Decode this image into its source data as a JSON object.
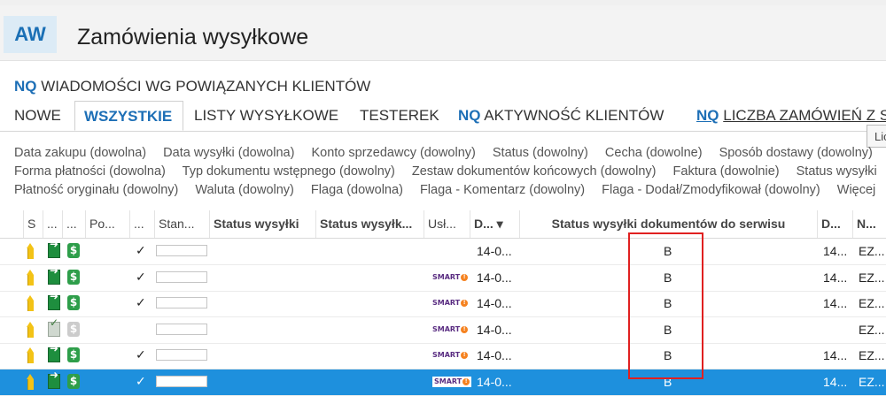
{
  "app": {
    "logo": "AW",
    "title": "Zamówienia wysyłkowe"
  },
  "saved_view": {
    "prefix": "NQ",
    "label": "WIADOMOŚCI WG POWIĄZANYCH KLIENTÓW"
  },
  "tabs": [
    {
      "label": "NOWE"
    },
    {
      "label": "WSZYSTKIE",
      "active": true
    },
    {
      "label": "LISTY WYSYŁKOWE"
    },
    {
      "label": "TESTEREK"
    },
    {
      "prefix": "NQ",
      "label": "AKTYWNOŚĆ KLIENTÓW"
    },
    {
      "prefix": "NQ",
      "label": "LICZBA ZAMÓWIEŃ Z S"
    }
  ],
  "tooltip": "Lic",
  "filters": {
    "row1": [
      "Data zakupu (dowolna)",
      "Data wysyłki (dowolna)",
      "Konto sprzedawcy (dowolny)",
      "Status (dowolny)",
      "Cecha (dowolne)",
      "Sposób dostawy (dowolny)"
    ],
    "row2": [
      "Forma płatności (dowolna)",
      "Typ dokumentu wstępnego (dowolny)",
      "Zestaw dokumentów końcowych (dowolny)",
      "Faktura (dowolnie)",
      "Status wysyłki"
    ],
    "row3": [
      "Płatność oryginału (dowolny)",
      "Waluta (dowolny)",
      "Flaga (dowolna)",
      "Flaga - Komentarz (dowolny)",
      "Flaga - Dodał/Zmodyfikował (dowolny)",
      "Więcej"
    ]
  },
  "grid": {
    "headers": {
      "c0": "",
      "c1": "S",
      "c2": "...",
      "c3": "...",
      "c4": "Po...",
      "c5": "...",
      "c6": "Stan...",
      "c7": "Status wysyłki",
      "c8": "Status wysyłk...",
      "c9": "Usł...",
      "c10": "D... ▾",
      "c11": "Status wysyłki dokumentów do serwisu",
      "c12": "D...",
      "c13": "N..."
    },
    "rows": [
      {
        "check": "✓",
        "smart": false,
        "date": "14-0...",
        "status_doc": "B",
        "d": "14...",
        "n": "EZ...",
        "gray": false,
        "selected": false
      },
      {
        "check": "✓",
        "smart": true,
        "date": "14-0...",
        "status_doc": "B",
        "d": "14...",
        "n": "EZ...",
        "gray": false,
        "selected": false
      },
      {
        "check": "✓",
        "smart": true,
        "date": "14-0...",
        "status_doc": "B",
        "d": "14...",
        "n": "EZ...",
        "gray": false,
        "selected": false
      },
      {
        "check": "",
        "smart": true,
        "date": "14-0...",
        "status_doc": "B",
        "d": "",
        "n": "EZ...",
        "gray": true,
        "selected": false
      },
      {
        "check": "✓",
        "smart": true,
        "date": "14-0...",
        "status_doc": "B",
        "d": "14...",
        "n": "EZ...",
        "gray": false,
        "selected": false
      },
      {
        "check": "✓",
        "smart": true,
        "date": "14-0...",
        "status_doc": "B",
        "d": "14...",
        "n": "EZ...",
        "gray": false,
        "selected": true
      }
    ],
    "smart_text": "SMART"
  },
  "colors": {
    "accent": "#1d6fb6",
    "selected_row": "#1e90dd",
    "highlight_box": "#e02020"
  }
}
